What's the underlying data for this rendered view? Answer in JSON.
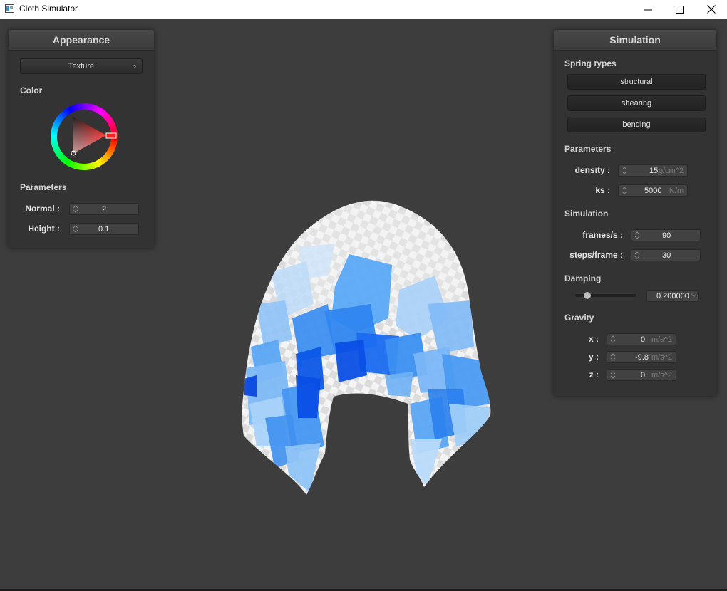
{
  "window": {
    "title": "Cloth Simulator"
  },
  "appearance": {
    "header": "Appearance",
    "texture_button": "Texture",
    "texture_chevron": "›",
    "color_label": "Color",
    "parameters_label": "Parameters",
    "normal_label": "Normal :",
    "normal_value": "2",
    "height_label": "Height :",
    "height_value": "0.1"
  },
  "simulation_panel": {
    "header": "Simulation",
    "spring_types_label": "Spring types",
    "spring_buttons": [
      "structural",
      "shearing",
      "bending"
    ],
    "parameters_label": "Parameters",
    "density_label": "density :",
    "density_value": "15",
    "density_unit": "g/cm^2",
    "ks_label": "ks :",
    "ks_value": "5000",
    "ks_unit": "N/m",
    "simulation_label": "Simulation",
    "fps_label": "frames/s :",
    "fps_value": "90",
    "steps_label": "steps/frame :",
    "steps_value": "30",
    "damping_label": "Damping",
    "damping_value": "0.200000",
    "damping_unit": "%",
    "damping_fraction": 0.2,
    "gravity_label": "Gravity",
    "x_label": "x :",
    "x_value": "0",
    "y_label": "y :",
    "y_value": "-9.8",
    "z_label": "z :",
    "z_value": "0",
    "gravity_unit": "m/s^2"
  },
  "colors": {
    "cloth_light": "#9fd0f7",
    "cloth_mid": "#3f9af0",
    "cloth_dark": "#0a55e8",
    "background": "#3d3d3d",
    "panel": "#333333"
  }
}
